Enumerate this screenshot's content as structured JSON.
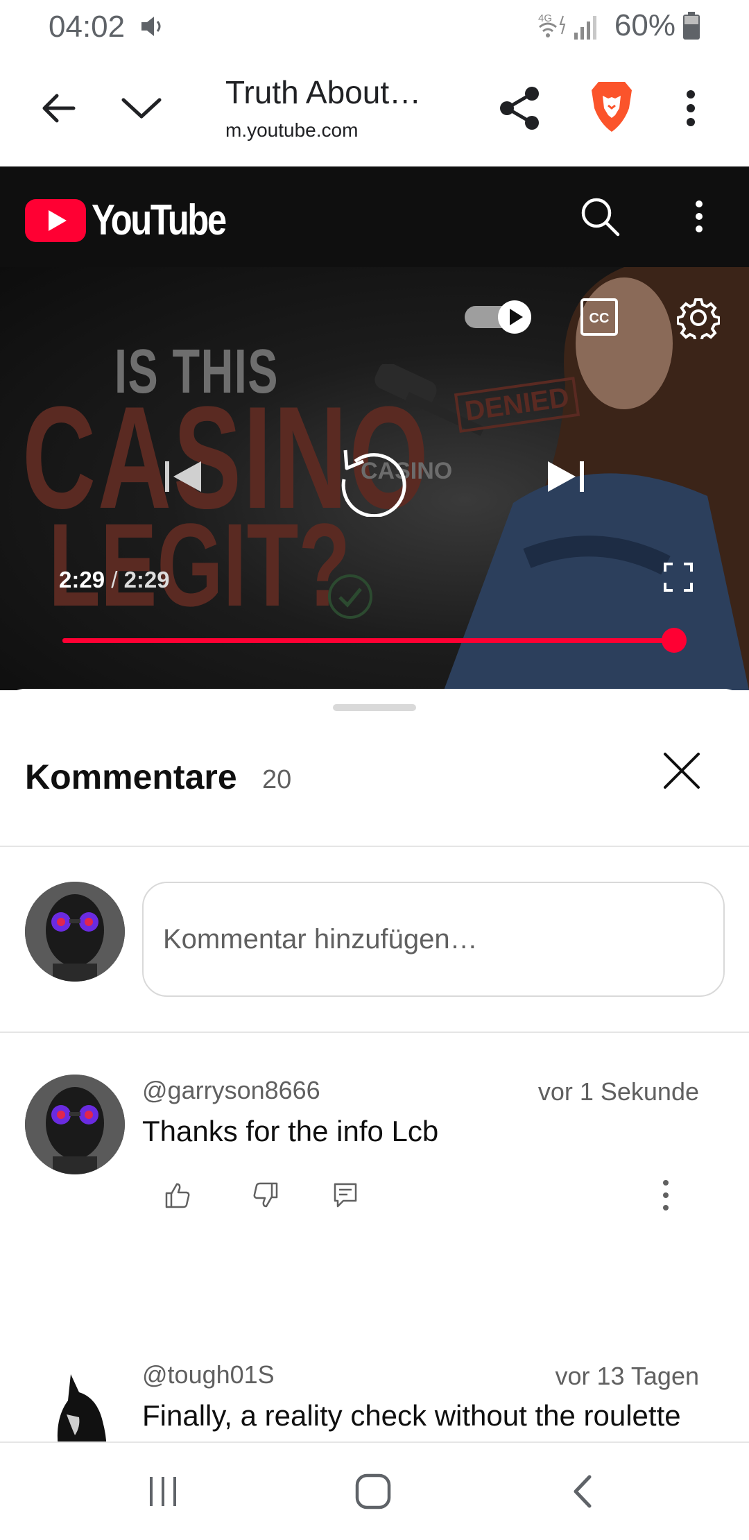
{
  "status_bar": {
    "time": "04:02",
    "network_label": "4G",
    "battery": "60%"
  },
  "browser": {
    "page_title": "Truth About…",
    "url": "m.youtube.com"
  },
  "youtube": {
    "logo_text": "YouTube",
    "brand_color": "#ff0033"
  },
  "video": {
    "thumbnail_text_1": "IS THIS",
    "thumbnail_text_2": "CASINO",
    "thumbnail_text_3": "LEGIT?",
    "thumbnail_badge": "DENIED",
    "thumbnail_laptop_text": "CASINO",
    "current_time": "2:29",
    "separator": "/",
    "duration": "2:29",
    "progress_fraction": 1.0,
    "autoplay_on": true,
    "cc_label": "CC"
  },
  "comments": {
    "title": "Kommentare",
    "count": "20",
    "add_placeholder": "Kommentar hinzufügen…",
    "items": [
      {
        "author": "@garryson8666",
        "time": "vor 1 Sekunde",
        "text": "Thanks for the info Lcb"
      },
      {
        "author": "@tough01S",
        "time": "vor 13 Tagen",
        "text": "Finally, a reality check without the roulette"
      }
    ]
  }
}
